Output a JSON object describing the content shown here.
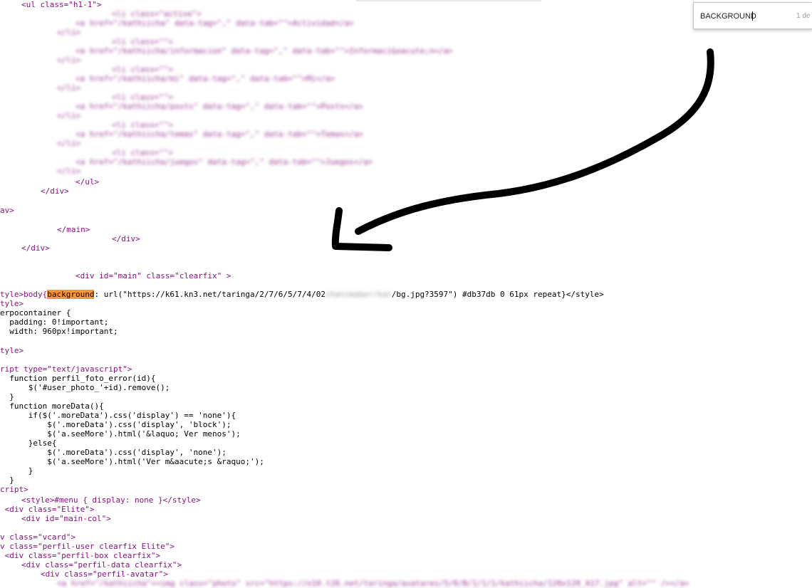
{
  "find_bar": {
    "query": "BACKGROUND",
    "match_count": "1 de"
  },
  "source": {
    "ul_open": "<ul class=\"h1-1\">",
    "li_active": "<li class=\"active\">",
    "li_empty": "<li class=\"\">",
    "li_close": "</li>",
    "link_1": "<a href=\"/kathiicha\" data-tag=\",\" data-tab=\"\">Actividad</a>",
    "link_2": "<a href=\"/kathiicha/informacion\" data-tag=\",\" data-tab=\"\">Informaci&oacute;n</a>",
    "link_3": "<a href=\"/kathiicha/mi\" data-tag=\",\" data-tab=\"\">Mi</a>",
    "link_4": "<a href=\"/kathiicha/posts\" data-tag=\",\" data-tab=\"\">Posts</a>",
    "link_5": "<a href=\"/kathiicha/temas\" data-tag=\",\" data-tab=\"\">Temas</a>",
    "link_6": "<a href=\"/kathiicha/juegos\" data-tag=\",\" data-tab=\"\">Juegos</a>",
    "li_last_close": "</li>",
    "ul_close": "</ul>",
    "div_close": "</div>",
    "nav_close": "av>",
    "main_close": "</main>",
    "div_close_2": "</div>",
    "div_close_3": "</div>",
    "main_div": "<div id=\"main\" class=\"clearfix\" >",
    "style_line_pre": "tyle>body{",
    "style_line_match": "background",
    "style_line_url_a": ": url(\"https://k61.kn3.net/taringa/2/7/6/5/7/4/02",
    "style_line_url_blur": "chanimaber/kat",
    "style_line_post": "/bg.jpg?3597\") #db37db 0 61px repeat}</style>",
    "style_open": "tyle>",
    "cuerpo": "erpocontainer {",
    "padding": "  padding: 0!important;",
    "width": "  width: 960px!important;",
    "style_close": "tyle>",
    "script_open": "ript type=\"text/javascript\">",
    "fn1": "  function perfil_foto_error(id){",
    "fn1_body": "      $('#user_photo_'+id).remove();",
    "fn1_close": "  }",
    "fn2": "  function moreData(){",
    "if_line": "      if($('.moreData').css('display') == 'none'){",
    "if_1": "          $('.moreData').css('display', 'block');",
    "if_2": "          $('a.seeMore').html('&laquo; Ver menos');",
    "else_line": "      }else{",
    "else_1": "          $('.moreData').css('display', 'none');",
    "else_2": "          $('a.seeMore').html('Ver m&aacute;s &raquo;');",
    "if_close": "      }",
    "fn2_close": "  }",
    "script_close": "cript>",
    "menu_style": "<style>#menu { display: none }</style>",
    "div_elite": " <div class=\"Elite\">",
    "div_maincol": "<div id=\"main-col\">",
    "vcard": "v class=\"vcard\">",
    "perfil_user": "v class=\"perfil-user clearfix Elite\">",
    "perfil_box": " <div class=\"perfil-box clearfix\">",
    "perfil_data": "<div class=\"perfil-data clearfix\">",
    "perfil_avatar": "<div class=\"perfil-avatar\">",
    "avatar_link": "<a href=\"/kathiicha\"><img class=\"photo\" src=\"https://o10.t26.net/taringa/avatares/5/0/B/1/1/1/kathiicha/120x120_A17.jpg\" alt=\"\" /></a>"
  },
  "colors": {
    "highlight": "#ff9632",
    "arrow": "#000000"
  },
  "annotation": {
    "icon": "hand-drawn-arrow-icon"
  }
}
